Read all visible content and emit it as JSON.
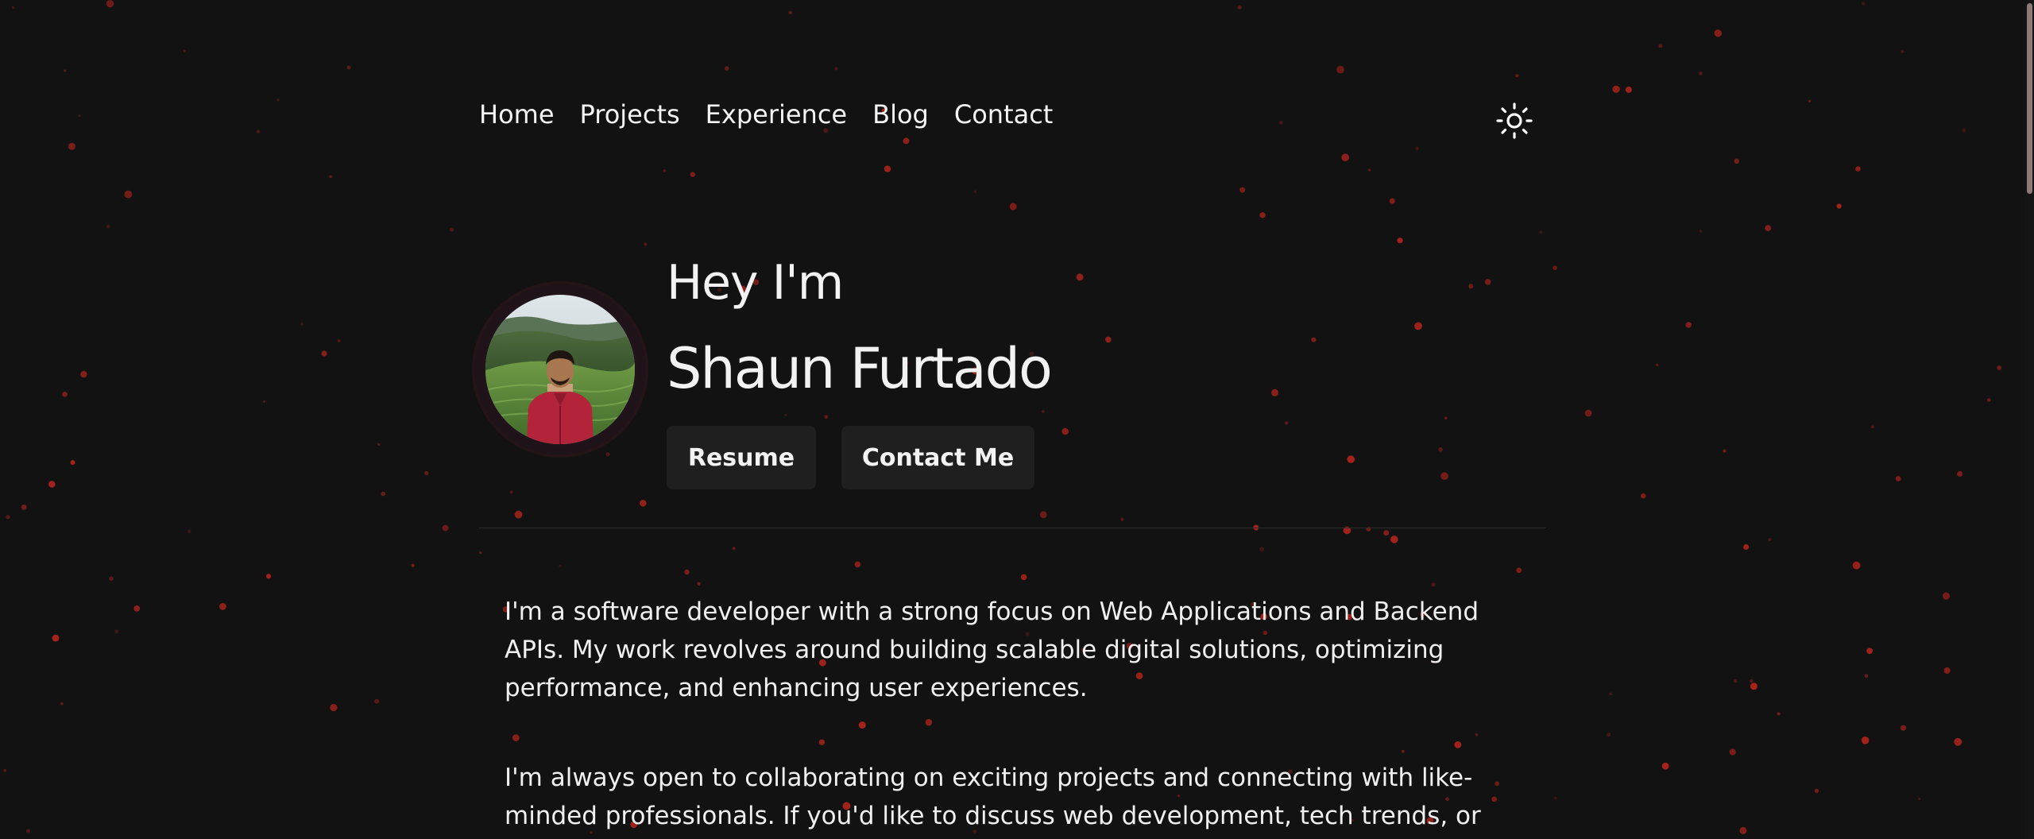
{
  "nav": {
    "items": [
      "Home",
      "Projects",
      "Experience",
      "Blog",
      "Contact"
    ]
  },
  "theme_toggle": {
    "icon": "sun-icon"
  },
  "hero": {
    "greeting": "Hey I'm",
    "name": "Shaun Furtado",
    "avatar": "profile-photo",
    "buttons": {
      "resume": "Resume",
      "contact": "Contact Me"
    }
  },
  "about": {
    "paragraph_1": "I'm a software developer with a strong focus on Web Applications and Backend APIs. My work revolves around building scalable digital solutions, optimizing performance, and enhancing user experiences.",
    "paragraph_2": "I'm always open to collaborating on exciting projects and connecting with like-minded professionals. If you'd like to discuss web development, tech trends, or"
  },
  "colors": {
    "background": "#121212",
    "particle": "#b2241c",
    "button_bg": "#1f1f1f",
    "text": "#f2f2f2"
  }
}
